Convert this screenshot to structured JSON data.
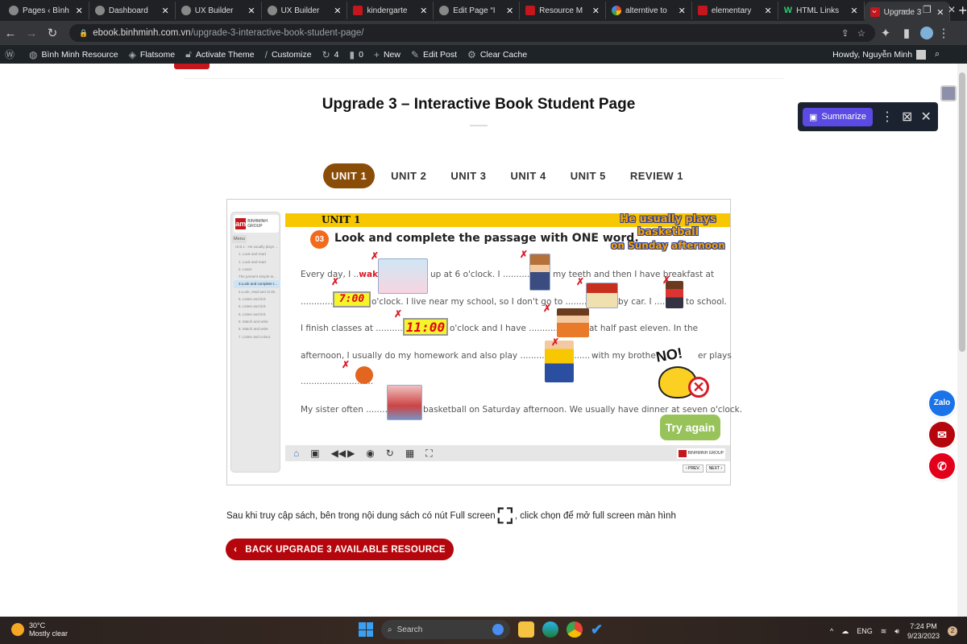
{
  "browser": {
    "tabs": [
      {
        "title": "Pages ‹ Bình",
        "icon": "globe-icon"
      },
      {
        "title": "Dashboard",
        "icon": "globe-icon"
      },
      {
        "title": "UX Builder",
        "icon": "globe-icon"
      },
      {
        "title": "UX Builder",
        "icon": "globe-icon"
      },
      {
        "title": "kindergarte",
        "icon": "bm-logo-icon"
      },
      {
        "title": "Edit Page “I",
        "icon": "globe-icon"
      },
      {
        "title": "Resource M",
        "icon": "bm-logo-icon"
      },
      {
        "title": "alterntive to",
        "icon": "google-icon"
      },
      {
        "title": "elementary",
        "icon": "bm-logo-icon"
      },
      {
        "title": "HTML Links",
        "icon": "w3-icon"
      },
      {
        "title": "Upgrade 3",
        "icon": "bm-logo-icon",
        "active": true
      }
    ],
    "url_host": "ebook.binhminh.com.vn",
    "url_path": "/upgrade-3-interactive-book-student-page/"
  },
  "wpbar": {
    "items": [
      {
        "label": "",
        "icon": "wordpress-icon"
      },
      {
        "label": "Bình Minh Resource",
        "icon": "dashboard-icon"
      },
      {
        "label": "Flatsome",
        "icon": "flatsome-icon"
      },
      {
        "label": "Activate Theme",
        "icon": "lock-icon"
      },
      {
        "label": "Customize",
        "icon": "brush-icon"
      },
      {
        "label": "4",
        "icon": "refresh-icon"
      },
      {
        "label": "0",
        "icon": "comment-icon"
      },
      {
        "label": "New",
        "icon": "plus-icon"
      },
      {
        "label": "Edit Post",
        "icon": "pencil-icon"
      },
      {
        "label": "Clear Cache",
        "icon": "gear-icon"
      }
    ],
    "howdy": "Howdy, Nguyễn Minh"
  },
  "page": {
    "title": "Upgrade 3 – Interactive Book Student Page",
    "units": [
      "UNIT 1",
      "UNIT 2",
      "UNIT 3",
      "UNIT 4",
      "UNIT 5",
      "REVIEW 1"
    ],
    "active_unit": "UNIT 1",
    "note_before": "Sau khi truy cập sách, bên trong nội dung sách có nút Full screen",
    "note_after": ", click chọn để mở full screen màn hình",
    "back_button": "BACK UPGRADE 3 AVAILABLE RESOURCE"
  },
  "book": {
    "brand": "BINHMINH GROUP",
    "menu_label": "Menu",
    "menu": [
      "Unit 1 : He usually plays ...",
      "1. Look and read",
      "1. Look and read",
      "2. Learn",
      "The present simple te...",
      "3.Look and complete t...",
      "4.Look, read and circle.",
      "5. Listen and tick",
      "5. Listen and tick",
      "5. Listen and tick",
      "6. Match and write",
      "6. Match and write",
      "7. Listen and colour."
    ],
    "selected_menu": 5,
    "unit_label": "UNIT 1",
    "header_line1": "He usually plays basketball",
    "header_line2": "on Sunday afternoon",
    "exercise_number": "03",
    "instruction": "Look and complete the passage with ONE word.",
    "answer": "wake",
    "clock1": "7:00",
    "clock2": "11:00",
    "lines": {
      "l1a": "Every day, I ..",
      "l1b": ". ",
      "l1c": "up at 6 o'clock. I ................",
      "l1d": "my teeth and then I have breakfast at",
      "l2a": "................",
      "l2b": "o'clock. I live near my school, so I don't go to ....................",
      "l2c": "by car. I ..........",
      "l2d": "to school.",
      "l3a": "I finish classes at ..................",
      "l3b": "o'clock and I have ..................",
      "l3c": "at half past eleven. In the",
      "l4a": "afternoon, I usually do my homework and also play ..........................",
      "l4b": "with my brothe",
      "l4c": "er plays",
      "l5": "...........................",
      "l6a": "My sister often ............",
      "l6b": "basketball on Saturday afternoon. We usually have dinner at seven o'clock."
    },
    "no_label": "NO!",
    "try_again": "Try again",
    "prev": "‹ PREV.",
    "next": "NEXT ›"
  },
  "extension": {
    "summarize": "Summarize"
  },
  "floating": [
    "Zalo"
  ],
  "taskbar": {
    "temp": "30°C",
    "weather": "Mostly clear",
    "search": "Search",
    "lang": "ENG",
    "time": "7:24 PM",
    "date": "9/23/2023",
    "notifications": "2"
  }
}
